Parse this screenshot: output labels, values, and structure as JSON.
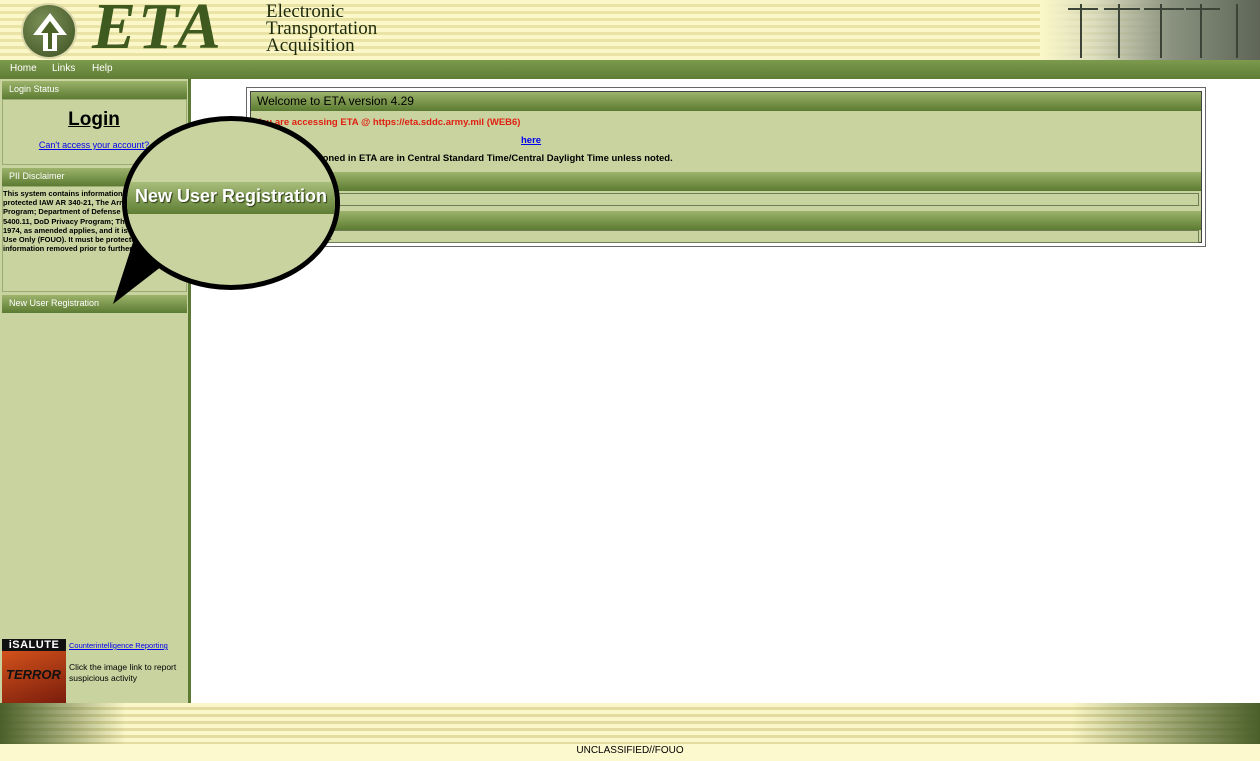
{
  "header": {
    "logo_text": "ETA",
    "subtitle_lines": [
      "Electronic",
      "Transportation",
      "Acquisition"
    ]
  },
  "nav": {
    "items": [
      {
        "label": "Home"
      },
      {
        "label": "Links"
      },
      {
        "label": "Help"
      }
    ]
  },
  "sidebar": {
    "login_status_header": "Login Status",
    "login_title": "Login",
    "cant_access_link": "Can't access your account?",
    "pii_header": "PII Disclaimer",
    "pii_text": "This system contains information that must be protected IAW AR 340-21, The Army Privacy Program; Department of Defense (DoD) Directive 5400.11, DoD Privacy Program; The Privacy Act of 1974, as amended applies, and it is For Official Use Only (FOUO). It must be protected or privacy information removed prior to further disclosure.",
    "new_user_header": "New User Registration",
    "salute": {
      "banner": "iSALUTE",
      "image_word": "TERROR",
      "link": "Counterintelligence Reporting",
      "caption": "Click the image link to report suspicious activity"
    }
  },
  "main": {
    "welcome_title": "Welcome to ETA version 4.29",
    "accessing_text": "You are accessing ETA @ https://eta.sddc.army.mil (WEB6)",
    "here_link": "here",
    "time_note": "All times mentioned in ETA are in Central Standard Time/Central Daylight Time unless noted.",
    "small_text": "y."
  },
  "callout": {
    "label": "New User Registration"
  },
  "footer": {
    "classification": "UNCLASSIFIED//FOUO"
  },
  "colors": {
    "accent_green": "#5c7b32",
    "panel_green": "#c8d3a0",
    "warning_red": "#e02010",
    "link_blue": "#0000ee"
  }
}
